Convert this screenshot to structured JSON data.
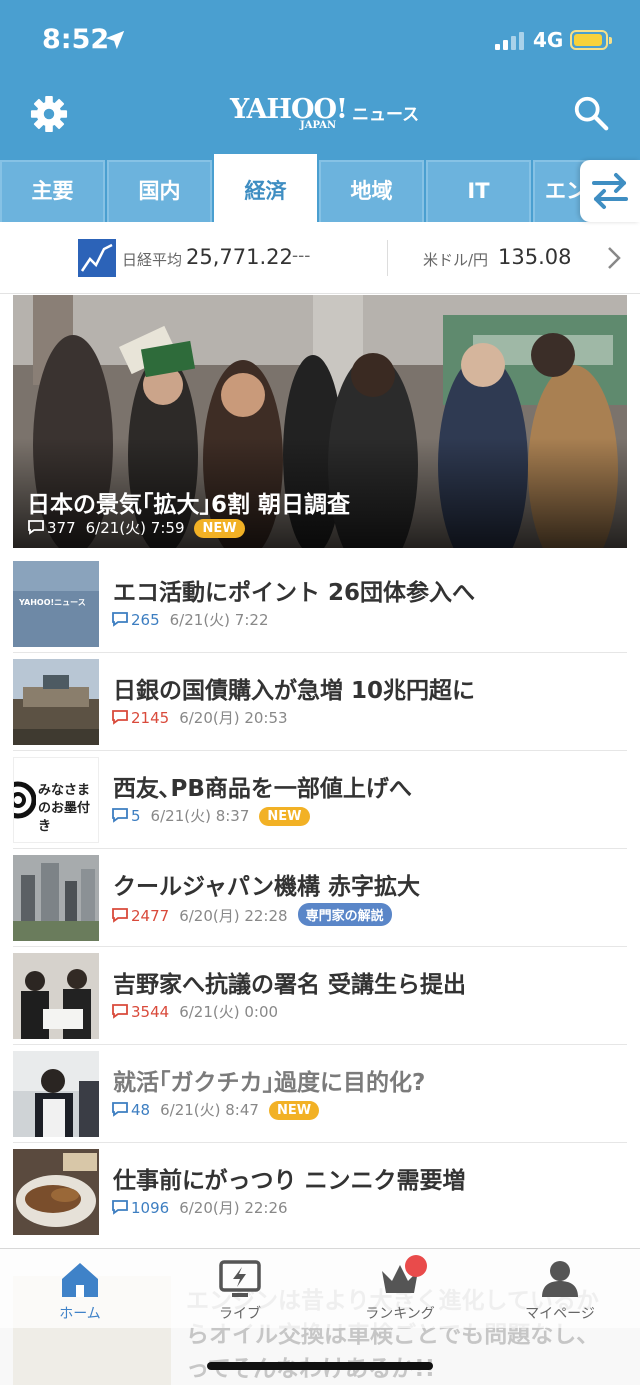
{
  "status": {
    "time": "8:52",
    "network": "4G"
  },
  "header": {
    "logo_main": "YAHOO!",
    "logo_sub": "JAPAN",
    "logo_service": "ニュース"
  },
  "tabs": [
    {
      "label": "主要"
    },
    {
      "label": "国内"
    },
    {
      "label": "経済",
      "active": true
    },
    {
      "label": "地域"
    },
    {
      "label": "IT"
    },
    {
      "label": "エン"
    }
  ],
  "market": {
    "nikkei_label": "日経平均",
    "nikkei_value": "25,771.22",
    "nikkei_change": "---",
    "fx_label": "米ドル/円",
    "fx_value": "135.08"
  },
  "hero": {
    "title": "日本の景気｢拡大｣6割 朝日調査",
    "comments": "377",
    "time": "6/21(火) 7:59",
    "badge": "NEW"
  },
  "articles": [
    {
      "title": "エコ活動にポイント 26団体参入へ",
      "comments": "265",
      "comment_color": "blue",
      "time": "6/21(火) 7:22",
      "badge": "",
      "thumb_text": "YAHOO!ニュース"
    },
    {
      "title": "日銀の国債購入が急増 10兆円超に",
      "comments": "2145",
      "comment_color": "red",
      "time": "6/20(月) 20:53",
      "badge": ""
    },
    {
      "title": "西友､PB商品を一部値上げへ",
      "comments": "5",
      "comment_color": "blue",
      "time": "6/21(火) 8:37",
      "badge": "NEW",
      "thumb_text": "みなさまのお墨付き"
    },
    {
      "title": "クールジャパン機構 赤字拡大",
      "comments": "2477",
      "comment_color": "red",
      "time": "6/20(月) 22:28",
      "badge": "専門家の解説"
    },
    {
      "title": "吉野家へ抗議の署名 受講生ら提出",
      "comments": "3544",
      "comment_color": "red",
      "time": "6/21(火) 0:00",
      "badge": ""
    },
    {
      "title": "就活｢ガクチカ｣過度に目的化?",
      "comments": "48",
      "comment_color": "blue",
      "time": "6/21(火) 8:47",
      "badge": "NEW",
      "read": true
    },
    {
      "title": "仕事前にがっつり ニンニク需要増",
      "comments": "1096",
      "comment_color": "blue",
      "time": "6/20(月) 22:26",
      "badge": ""
    }
  ],
  "behind_text": "エンジンは昔より大きく進化しているからオイル交換は車検ごとでも問題なし、ってそんなわけあるか!!",
  "tabbar": [
    {
      "label": "ホーム",
      "icon": "home-icon",
      "active": true
    },
    {
      "label": "ライブ",
      "icon": "live-icon"
    },
    {
      "label": "ランキング",
      "icon": "crown-icon"
    },
    {
      "label": "マイページ",
      "icon": "person-icon"
    }
  ],
  "colors": {
    "header": "#4a9fd0",
    "accent": "#3f8ec2",
    "new_badge": "#f2b125",
    "expert_badge": "#5a86c8",
    "comment_red": "#d94a3b",
    "comment_blue": "#3d7ec1"
  }
}
